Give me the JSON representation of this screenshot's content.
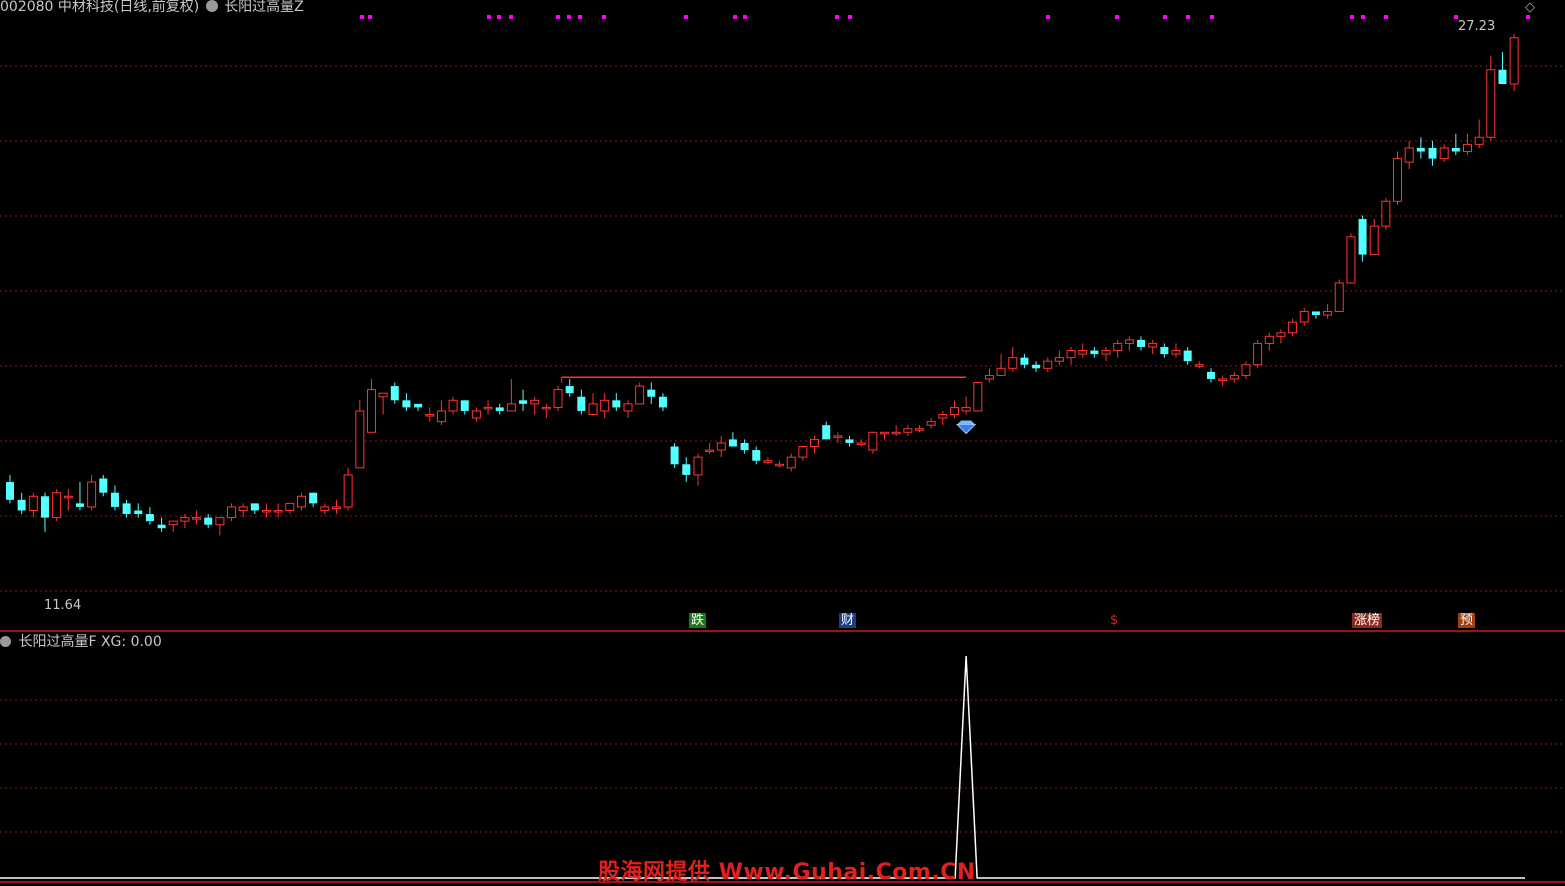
{
  "header": {
    "stock_title": "002080 中材科技(日线,前复权)",
    "indicator_name": "长阳过高量Z"
  },
  "indicator_panel": {
    "name": "长阳过高量F",
    "value_label": "XG: 0.00"
  },
  "price_labels": {
    "high": "27.23",
    "low": "11.64"
  },
  "event_flags": [
    {
      "label": "跌",
      "bg": "#1a7a1a",
      "color": "#ffffff"
    },
    {
      "label": "财",
      "bg": "#1a3f8a",
      "color": "#ffffff"
    },
    {
      "label": "$",
      "bg": "#000000",
      "color": "#e0201c"
    },
    {
      "label": "涨榜",
      "bg": "#8a2a1a",
      "color": "#ffffff"
    },
    {
      "label": "预",
      "bg": "#a04010",
      "color": "#ffffff"
    }
  ],
  "watermark": "股海网提供 Www.Guhai.Com.CN",
  "colors": {
    "up": "#ff3232",
    "down": "#54ffff",
    "signal": "#ff00ff",
    "gridline": "#8b1a1a",
    "separator": "#c81e1e",
    "indicator_line": "#ffffff"
  },
  "chart_data": {
    "type": "candlestick",
    "price_range": [
      11.0,
      27.6
    ],
    "candles": [
      [
        14.6,
        14.8,
        14.0,
        14.1
      ],
      [
        14.1,
        14.3,
        13.7,
        13.8
      ],
      [
        13.8,
        14.3,
        13.6,
        14.2
      ],
      [
        14.2,
        14.3,
        13.2,
        13.6
      ],
      [
        13.6,
        14.4,
        13.5,
        14.3
      ],
      [
        14.2,
        14.4,
        13.8,
        14.2
      ],
      [
        14.0,
        14.6,
        13.8,
        13.9
      ],
      [
        13.9,
        14.8,
        13.8,
        14.6
      ],
      [
        14.7,
        14.8,
        14.2,
        14.3
      ],
      [
        14.3,
        14.5,
        13.8,
        13.9
      ],
      [
        14.0,
        14.1,
        13.6,
        13.7
      ],
      [
        13.8,
        14.0,
        13.6,
        13.7
      ],
      [
        13.7,
        13.9,
        13.4,
        13.5
      ],
      [
        13.4,
        13.6,
        13.2,
        13.3
      ],
      [
        13.4,
        13.5,
        13.2,
        13.5
      ],
      [
        13.5,
        13.7,
        13.3,
        13.6
      ],
      [
        13.6,
        13.8,
        13.4,
        13.6
      ],
      [
        13.6,
        13.7,
        13.3,
        13.4
      ],
      [
        13.4,
        13.6,
        13.1,
        13.6
      ],
      [
        13.6,
        14.0,
        13.5,
        13.9
      ],
      [
        13.8,
        14.0,
        13.6,
        13.9
      ],
      [
        14.0,
        14.0,
        13.7,
        13.8
      ],
      [
        13.8,
        14.0,
        13.6,
        13.8
      ],
      [
        13.8,
        14.0,
        13.6,
        13.8
      ],
      [
        13.8,
        14.0,
        13.7,
        14.0
      ],
      [
        13.9,
        14.3,
        13.8,
        14.2
      ],
      [
        14.3,
        14.3,
        13.9,
        14.0
      ],
      [
        13.8,
        14.0,
        13.7,
        13.9
      ],
      [
        13.9,
        14.1,
        13.7,
        13.9
      ],
      [
        13.9,
        15.0,
        13.8,
        14.8
      ],
      [
        15.0,
        16.9,
        15.0,
        16.6
      ],
      [
        16.0,
        17.5,
        16.0,
        17.2
      ],
      [
        17.0,
        17.1,
        16.5,
        17.1
      ],
      [
        17.3,
        17.4,
        16.8,
        16.9
      ],
      [
        16.9,
        17.1,
        16.6,
        16.7
      ],
      [
        16.8,
        16.8,
        16.6,
        16.7
      ],
      [
        16.5,
        16.7,
        16.3,
        16.5
      ],
      [
        16.3,
        16.9,
        16.2,
        16.6
      ],
      [
        16.6,
        17.0,
        16.5,
        16.9
      ],
      [
        16.9,
        16.9,
        16.5,
        16.6
      ],
      [
        16.4,
        16.7,
        16.3,
        16.6
      ],
      [
        16.7,
        16.9,
        16.5,
        16.7
      ],
      [
        16.7,
        16.8,
        16.5,
        16.6
      ],
      [
        16.6,
        17.5,
        16.6,
        16.8
      ],
      [
        16.9,
        17.2,
        16.6,
        16.8
      ],
      [
        16.8,
        17.0,
        16.5,
        16.9
      ],
      [
        16.7,
        16.8,
        16.4,
        16.7
      ],
      [
        16.7,
        17.3,
        16.6,
        17.2
      ],
      [
        17.3,
        17.5,
        17.0,
        17.1
      ],
      [
        17.0,
        17.2,
        16.5,
        16.6
      ],
      [
        16.5,
        17.1,
        16.5,
        16.8
      ],
      [
        16.6,
        17.1,
        16.4,
        16.9
      ],
      [
        16.9,
        17.1,
        16.6,
        16.7
      ],
      [
        16.6,
        16.9,
        16.4,
        16.8
      ],
      [
        16.8,
        17.4,
        16.8,
        17.3
      ],
      [
        17.2,
        17.4,
        16.8,
        17.0
      ],
      [
        17.0,
        17.1,
        16.6,
        16.7
      ],
      [
        15.6,
        15.7,
        15.0,
        15.1
      ],
      [
        15.1,
        15.3,
        14.6,
        14.8
      ],
      [
        14.8,
        15.4,
        14.5,
        15.3
      ],
      [
        15.5,
        15.7,
        15.4,
        15.5
      ],
      [
        15.5,
        15.9,
        15.3,
        15.7
      ],
      [
        15.8,
        16.0,
        15.6,
        15.6
      ],
      [
        15.7,
        15.8,
        15.4,
        15.5
      ],
      [
        15.5,
        15.6,
        15.1,
        15.2
      ],
      [
        15.2,
        15.3,
        15.1,
        15.2
      ],
      [
        15.1,
        15.2,
        15.0,
        15.1
      ],
      [
        15.0,
        15.4,
        14.9,
        15.3
      ],
      [
        15.3,
        15.6,
        15.2,
        15.6
      ],
      [
        15.6,
        15.9,
        15.4,
        15.8
      ],
      [
        16.2,
        16.3,
        15.8,
        15.8
      ],
      [
        15.9,
        16.0,
        15.7,
        15.9
      ],
      [
        15.8,
        15.9,
        15.6,
        15.7
      ],
      [
        15.7,
        15.8,
        15.6,
        15.7
      ],
      [
        15.5,
        16.0,
        15.4,
        16.0
      ],
      [
        16.0,
        16.0,
        15.8,
        16.0
      ],
      [
        16.0,
        16.2,
        15.9,
        16.0
      ],
      [
        16.0,
        16.2,
        15.9,
        16.1
      ],
      [
        16.1,
        16.2,
        16.0,
        16.1
      ],
      [
        16.2,
        16.4,
        16.1,
        16.3
      ],
      [
        16.4,
        16.6,
        16.2,
        16.5
      ],
      [
        16.5,
        16.9,
        16.4,
        16.7
      ],
      [
        16.6,
        17.0,
        16.5,
        16.7
      ],
      [
        16.6,
        17.3,
        16.6,
        17.4
      ],
      [
        17.5,
        17.8,
        17.4,
        17.6
      ],
      [
        17.6,
        18.2,
        17.6,
        17.8
      ],
      [
        17.8,
        18.4,
        17.7,
        18.1
      ],
      [
        18.1,
        18.2,
        17.8,
        17.9
      ],
      [
        17.9,
        18.0,
        17.7,
        17.8
      ],
      [
        17.8,
        18.1,
        17.7,
        18.0
      ],
      [
        18.0,
        18.3,
        17.9,
        18.1
      ],
      [
        18.1,
        18.4,
        17.9,
        18.3
      ],
      [
        18.2,
        18.5,
        18.1,
        18.3
      ],
      [
        18.3,
        18.4,
        18.1,
        18.2
      ],
      [
        18.2,
        18.4,
        18.0,
        18.3
      ],
      [
        18.3,
        18.6,
        18.1,
        18.5
      ],
      [
        18.5,
        18.7,
        18.3,
        18.6
      ],
      [
        18.6,
        18.7,
        18.3,
        18.4
      ],
      [
        18.4,
        18.6,
        18.2,
        18.5
      ],
      [
        18.4,
        18.5,
        18.1,
        18.2
      ],
      [
        18.2,
        18.5,
        18.1,
        18.3
      ],
      [
        18.3,
        18.4,
        17.9,
        18.0
      ],
      [
        17.9,
        18.0,
        17.8,
        17.9
      ],
      [
        17.7,
        17.8,
        17.4,
        17.5
      ],
      [
        17.5,
        17.6,
        17.3,
        17.5
      ],
      [
        17.5,
        17.7,
        17.4,
        17.6
      ],
      [
        17.6,
        18.0,
        17.5,
        17.9
      ],
      [
        17.9,
        18.6,
        17.8,
        18.5
      ],
      [
        18.5,
        18.8,
        18.3,
        18.7
      ],
      [
        18.7,
        18.9,
        18.5,
        18.8
      ],
      [
        18.8,
        19.2,
        18.7,
        19.1
      ],
      [
        19.1,
        19.5,
        19.0,
        19.4
      ],
      [
        19.4,
        19.4,
        19.2,
        19.3
      ],
      [
        19.3,
        19.6,
        19.2,
        19.4
      ],
      [
        19.4,
        20.3,
        19.4,
        20.2
      ],
      [
        20.2,
        21.6,
        20.2,
        21.5
      ],
      [
        22.0,
        22.1,
        20.8,
        21.0
      ],
      [
        21.0,
        22.0,
        21.0,
        21.8
      ],
      [
        21.8,
        22.6,
        21.7,
        22.5
      ],
      [
        22.5,
        23.9,
        22.4,
        23.7
      ],
      [
        23.6,
        24.2,
        23.4,
        24.0
      ],
      [
        24.0,
        24.3,
        23.7,
        23.9
      ],
      [
        24.0,
        24.2,
        23.5,
        23.7
      ],
      [
        23.7,
        24.1,
        23.6,
        24.0
      ],
      [
        24.0,
        24.4,
        23.8,
        23.9
      ],
      [
        23.9,
        24.4,
        23.8,
        24.1
      ],
      [
        24.1,
        24.8,
        24.0,
        24.3
      ],
      [
        24.3,
        26.6,
        24.2,
        26.2
      ],
      [
        26.2,
        26.7,
        25.8,
        25.8
      ],
      [
        25.8,
        27.2,
        25.6,
        27.1
      ]
    ],
    "reference_line": {
      "start_index": 48,
      "end_index": 82,
      "value": 17.55
    },
    "signal_index": 82,
    "indicator": {
      "name": "XG",
      "range": [
        0,
        1
      ],
      "spike_index": 82,
      "spike_value": 1
    }
  }
}
